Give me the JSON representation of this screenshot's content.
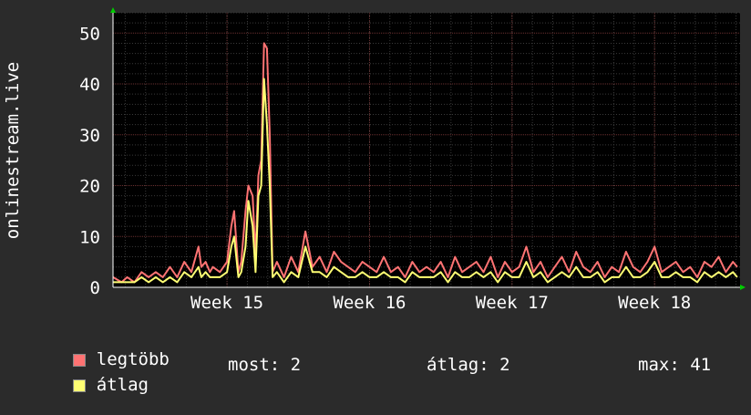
{
  "colors": {
    "background": "#2b2b2b",
    "plot_bg": "#000000",
    "max_series": "#ff7373",
    "avg_series": "#ffff73",
    "grid_major": "#6a3030",
    "grid_minor": "#3a3a3a",
    "axis": "#ffffff",
    "arrow": "#00cc00"
  },
  "chart_data": {
    "type": "line",
    "ylabel": "onlinestream.live",
    "ylim": [
      0,
      54
    ],
    "yticks": [
      0,
      10,
      20,
      30,
      40,
      50
    ],
    "xtick_labels": [
      {
        "label": "Week 15",
        "week": 15
      },
      {
        "label": "Week 16",
        "week": 16
      },
      {
        "label": "Week 17",
        "week": 17
      },
      {
        "label": "Week 18",
        "week": 18
      }
    ],
    "xlim_weeks": [
      14.2,
      18.6
    ],
    "grid": true,
    "series": [
      {
        "name": "legtöbb",
        "color": "#ff7373",
        "x_weeks": [
          14.2,
          14.26,
          14.3,
          14.35,
          14.4,
          14.45,
          14.5,
          14.55,
          14.6,
          14.65,
          14.7,
          14.75,
          14.8,
          14.82,
          14.85,
          14.88,
          14.9,
          14.95,
          15.0,
          15.03,
          15.05,
          15.08,
          15.1,
          15.13,
          15.15,
          15.18,
          15.2,
          15.22,
          15.24,
          15.26,
          15.28,
          15.3,
          15.32,
          15.35,
          15.4,
          15.45,
          15.5,
          15.55,
          15.6,
          15.65,
          15.7,
          15.75,
          15.8,
          15.85,
          15.9,
          15.95,
          16.0,
          16.05,
          16.1,
          16.15,
          16.2,
          16.25,
          16.3,
          16.35,
          16.4,
          16.45,
          16.5,
          16.55,
          16.6,
          16.65,
          16.7,
          16.75,
          16.8,
          16.85,
          16.9,
          16.95,
          17.0,
          17.05,
          17.1,
          17.15,
          17.2,
          17.25,
          17.3,
          17.35,
          17.4,
          17.45,
          17.5,
          17.55,
          17.6,
          17.65,
          17.7,
          17.75,
          17.8,
          17.85,
          17.9,
          17.95,
          18.0,
          18.05,
          18.1,
          18.15,
          18.2,
          18.25,
          18.3,
          18.35,
          18.4,
          18.45,
          18.5,
          18.55,
          18.58
        ],
        "values": [
          2,
          1,
          2,
          1,
          3,
          2,
          3,
          2,
          4,
          2,
          5,
          3,
          8,
          4,
          5,
          3,
          4,
          3,
          5,
          12,
          15,
          3,
          5,
          15,
          20,
          18,
          6,
          22,
          25,
          48,
          47,
          30,
          3,
          5,
          2,
          6,
          3,
          11,
          4,
          6,
          3,
          7,
          5,
          4,
          3,
          5,
          4,
          3,
          6,
          3,
          4,
          2,
          5,
          3,
          4,
          3,
          5,
          2,
          6,
          3,
          4,
          5,
          3,
          6,
          2,
          5,
          3,
          4,
          8,
          3,
          5,
          2,
          4,
          6,
          3,
          7,
          4,
          3,
          5,
          2,
          4,
          3,
          7,
          4,
          3,
          5,
          8,
          3,
          4,
          5,
          3,
          4,
          2,
          5,
          4,
          6,
          3,
          5,
          4
        ]
      },
      {
        "name": "átlag",
        "color": "#ffff73",
        "x_weeks": [
          14.2,
          14.26,
          14.3,
          14.35,
          14.4,
          14.45,
          14.5,
          14.55,
          14.6,
          14.65,
          14.7,
          14.75,
          14.8,
          14.82,
          14.85,
          14.88,
          14.9,
          14.95,
          15.0,
          15.03,
          15.05,
          15.08,
          15.1,
          15.13,
          15.15,
          15.18,
          15.2,
          15.22,
          15.24,
          15.26,
          15.28,
          15.3,
          15.32,
          15.35,
          15.4,
          15.45,
          15.5,
          15.55,
          15.6,
          15.65,
          15.7,
          15.75,
          15.8,
          15.85,
          15.9,
          15.95,
          16.0,
          16.05,
          16.1,
          16.15,
          16.2,
          16.25,
          16.3,
          16.35,
          16.4,
          16.45,
          16.5,
          16.55,
          16.6,
          16.65,
          16.7,
          16.75,
          16.8,
          16.85,
          16.9,
          16.95,
          17.0,
          17.05,
          17.1,
          17.15,
          17.2,
          17.25,
          17.3,
          17.35,
          17.4,
          17.45,
          17.5,
          17.55,
          17.6,
          17.65,
          17.7,
          17.75,
          17.8,
          17.85,
          17.9,
          17.95,
          18.0,
          18.05,
          18.1,
          18.15,
          18.2,
          18.25,
          18.3,
          18.35,
          18.4,
          18.45,
          18.5,
          18.55,
          18.58
        ],
        "values": [
          1,
          1,
          1,
          1,
          2,
          1,
          2,
          1,
          2,
          1,
          3,
          2,
          4,
          2,
          3,
          2,
          2,
          2,
          3,
          8,
          10,
          2,
          3,
          8,
          17,
          12,
          3,
          18,
          20,
          41,
          32,
          20,
          2,
          3,
          1,
          3,
          2,
          8,
          3,
          3,
          2,
          4,
          3,
          2,
          2,
          3,
          2,
          2,
          3,
          2,
          2,
          1,
          3,
          2,
          2,
          2,
          3,
          1,
          3,
          2,
          2,
          3,
          2,
          3,
          1,
          3,
          2,
          2,
          5,
          2,
          3,
          1,
          2,
          3,
          2,
          4,
          2,
          2,
          3,
          1,
          2,
          2,
          4,
          2,
          2,
          3,
          5,
          2,
          2,
          3,
          2,
          2,
          1,
          3,
          2,
          3,
          2,
          3,
          2
        ]
      }
    ],
    "annotations": []
  },
  "legend": {
    "items": [
      {
        "label": "legtöbb",
        "color": "#ff7373"
      },
      {
        "label": "átlag",
        "color": "#ffff73"
      }
    ]
  },
  "stats": {
    "now_text": "most: 2",
    "avg_text": "átlag: 2",
    "max_text": "max: 41"
  }
}
